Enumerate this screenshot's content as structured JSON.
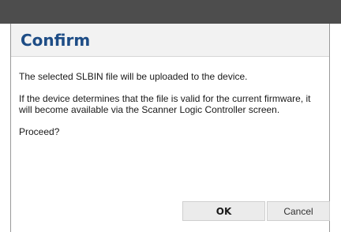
{
  "dialog": {
    "title": "Confirm",
    "paragraphs": [
      "The selected SLBIN file will be uploaded to the device.",
      "If the device determines that the file is valid for the current firmware, it will become available via the Scanner Logic Controller screen.",
      "Proceed?"
    ],
    "ok_label": "OK",
    "cancel_label": "Cancel"
  },
  "colors": {
    "title": "#1e4d86",
    "topbar": "#4d4d4d",
    "titlebar_bg": "#f2f2f2",
    "button_bg": "#ebebeb"
  }
}
